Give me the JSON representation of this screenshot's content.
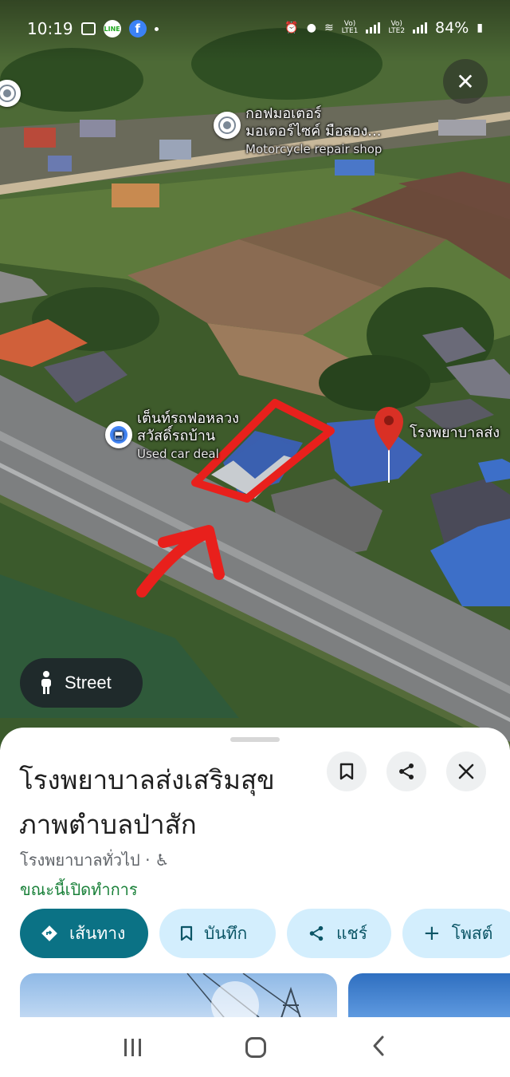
{
  "status_bar": {
    "time": "10:19",
    "line_label": "LINE",
    "fb_label": "f",
    "network_1": "Vo)\nLTE1",
    "network_2": "Vo)\nLTE2",
    "battery": "84%",
    "icons": [
      "gallery-icon",
      "line-app-icon",
      "facebook-icon",
      "alarm-icon",
      "location-icon",
      "wifi-icon",
      "signal-icon",
      "battery-icon"
    ]
  },
  "map": {
    "labels": {
      "golf_motor_th_1": "กอฟมอเตอร์",
      "golf_motor_th_2": "มอเตอร์ไซค์ มือสอง...",
      "golf_motor_en": "Motorcycle repair shop",
      "tent_th_1": "เต็นท์รถฟอหลวง",
      "tent_th_2": "สวัสดิ์รถบ้าน",
      "tent_en": "Used car deal",
      "hospital_label": "โรงพยาบาลส่ง"
    },
    "street_button": "Street",
    "pin_color": "#d93025",
    "annotation_color": "#e8201c"
  },
  "place": {
    "title_line1": "โรงพยาบาลส่งเสริมสุข",
    "title_line2": "ภาพตำบลป่าสัก",
    "category": "โรงพยาบาลทั่วไป ·",
    "accessibility_icon": "wheelchair-icon",
    "open_status": "ขณะนี้เปิดทำการ",
    "actions": {
      "directions": "เส้นทาง",
      "save": "บันทึก",
      "share": "แชร์",
      "post": "โพสต์"
    }
  },
  "colors": {
    "primary": "#0b7285",
    "chip_bg": "#d3eefd",
    "open_green": "#188038"
  }
}
